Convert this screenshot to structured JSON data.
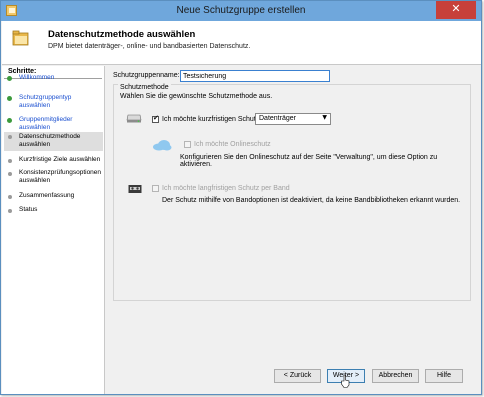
{
  "window": {
    "title": "Neue Schutzgruppe erstellen",
    "close_label": "✕"
  },
  "header": {
    "title": "Datenschutzmethode auswählen",
    "subtitle": "DPM bietet datenträger-, online- und bandbasierten Datenschutz."
  },
  "sidebar": {
    "steps_label": "Schritte:",
    "items": [
      {
        "label": "Willkommen",
        "status": "done"
      },
      {
        "label": "Schutzgruppentyp auswählen",
        "status": "done"
      },
      {
        "label": "Gruppenmitglieder auswählen",
        "status": "done"
      },
      {
        "label": "Datenschutzmethode auswählen",
        "status": "current"
      },
      {
        "label": "Kurzfristige Ziele auswählen",
        "status": "pending"
      },
      {
        "label": "Konsistenzprüfungsoptionen auswählen",
        "status": "pending"
      },
      {
        "label": "Zusammenfassung",
        "status": "pending"
      },
      {
        "label": "Status",
        "status": "pending"
      }
    ]
  },
  "form": {
    "group_name_label": "Schutzgruppenname:",
    "group_name_value": "Testsicherung",
    "method_group_title": "Schutzmethode",
    "method_prompt": "Wählen Sie die gewünschte Schutzmethode aus.",
    "short_term_label": "Ich möchte kurzfristigen Schutz per:",
    "short_term_checked": true,
    "short_term_select_value": "Datenträger",
    "online_label": "Ich möchte Onlineschutz",
    "online_checked": false,
    "online_desc": "Konfigurieren Sie den Onlineschutz auf der Seite \"Verwaltung\", um diese Option zu aktivieren.",
    "tape_label": "Ich möchte langfristigen Schutz per Band",
    "tape_checked": false,
    "tape_desc": "Der Schutz mithilfe von Bandoptionen ist deaktiviert, da keine Bandbibliotheken erkannt wurden."
  },
  "buttons": {
    "back": "< Zurück",
    "next": "Weiter >",
    "cancel": "Abbrechen",
    "help": "Hilfe"
  },
  "colors": {
    "titlebar": "#6fa7dc",
    "close": "#c7403a",
    "link": "#1a4fd0",
    "done_bullet": "#3c9a3c"
  }
}
